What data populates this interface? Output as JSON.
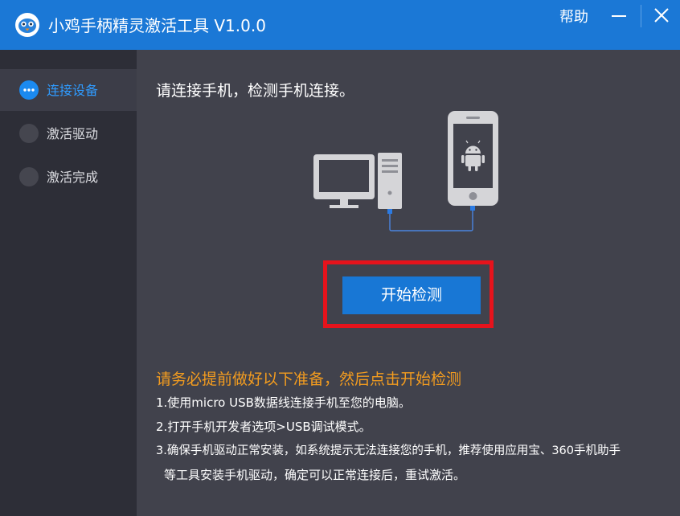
{
  "window": {
    "title": "小鸡手柄精灵激活工具 V1.0.0",
    "help_label": "帮助",
    "icons": {
      "logo": "gamepad-bird-logo-icon",
      "minimize": "minimize-icon",
      "close": "close-icon"
    },
    "colors": {
      "titlebar": "#1b78d6",
      "sidebar": "#2d2e37",
      "main": "#41424c",
      "accent": "#2f9bff",
      "warning": "#f39c1f",
      "highlight": "#e6131c"
    }
  },
  "sidebar": {
    "items": [
      {
        "label": "连接设备",
        "state": "active",
        "icon": "in-progress-dots-icon"
      },
      {
        "label": "激活驱动",
        "state": "pending",
        "icon": "pending-circle-icon"
      },
      {
        "label": "激活完成",
        "state": "pending",
        "icon": "pending-circle-icon"
      }
    ]
  },
  "main": {
    "instruction": "请连接手机，检测手机连接。",
    "illustration_icons": [
      "desktop-computer-icon",
      "android-phone-icon",
      "usb-cable-icon"
    ],
    "start_button_label": "开始检测",
    "preparation": {
      "heading": "请务必提前做好以下准备，然后点击开始检测",
      "steps": [
        "1.使用micro USB数据线连接手机至您的电脑。",
        "2.打开手机开发者选项>USB调试模式。",
        "3.确保手机驱动正常安装，如系统提示无法连接您的手机，推荐使用应用宝、360手机助手",
        "等工具安装手机驱动，确定可以正常连接后，重试激活。"
      ]
    }
  }
}
